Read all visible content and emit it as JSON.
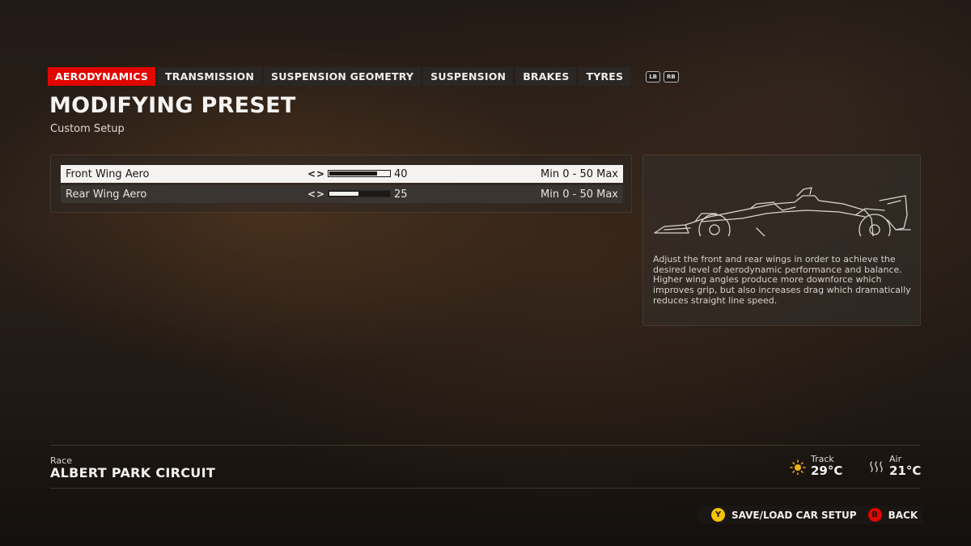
{
  "tabs": [
    {
      "label": "AERODYNAMICS",
      "active": true
    },
    {
      "label": "TRANSMISSION",
      "active": false
    },
    {
      "label": "SUSPENSION GEOMETRY",
      "active": false
    },
    {
      "label": "SUSPENSION",
      "active": false
    },
    {
      "label": "BRAKES",
      "active": false
    },
    {
      "label": "TYRES",
      "active": false
    }
  ],
  "bumpers": {
    "left": "LB",
    "right": "RB"
  },
  "header": {
    "title": "MODIFYING PRESET",
    "subtitle": "Custom Setup"
  },
  "settings": [
    {
      "label": "Front Wing Aero",
      "arrows": "<>",
      "value": "40",
      "fraction": 0.8,
      "range": "Min 0 - 50 Max",
      "selected": true
    },
    {
      "label": "Rear Wing Aero",
      "arrows": "<>",
      "value": "25",
      "fraction": 0.5,
      "range": "Min 0 - 50 Max",
      "selected": false
    }
  ],
  "info": {
    "image_icon": "f1-car-outline-icon",
    "paragraph1": "Adjust the front and rear wings in order to achieve the desired level of aerodynamic performance and balance.",
    "paragraph2": "Higher wing angles produce more downforce which improves grip, but also increases drag which dramatically reduces straight line speed."
  },
  "race": {
    "label": "Race",
    "name": "ALBERT PARK CIRCUIT"
  },
  "weather": {
    "track": {
      "label": "Track",
      "value": "29°C",
      "icon": "sun-icon"
    },
    "air": {
      "label": "Air",
      "value": "21°C",
      "icon": "heat-waves-icon"
    }
  },
  "prompts": [
    {
      "glyph": "Y",
      "label": "SAVE/LOAD CAR SETUP",
      "color": "#f5c400"
    },
    {
      "glyph": "B",
      "label": "BACK",
      "color": "#e10600"
    }
  ],
  "colors": {
    "accent": "#e10600",
    "y_button": "#f5c400"
  }
}
